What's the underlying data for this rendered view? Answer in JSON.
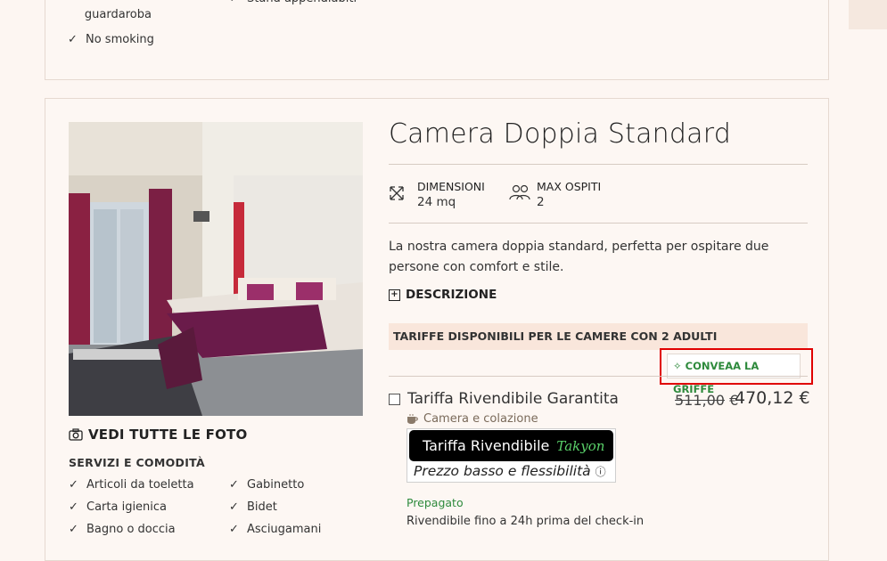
{
  "top_card": {
    "amenities_col1": [
      "Armadio o guardaroba",
      "No smoking"
    ],
    "amenities_col2": [
      "Stand appendiabiti"
    ]
  },
  "room": {
    "title": "Camera Doppia Standard",
    "dimensions_label": "DIMENSIONI",
    "dimensions_value": "24 mq",
    "max_guests_label": "MAX OSPITI",
    "max_guests_value": "2",
    "description": "La nostra camera doppia standard, perfetta per ospitare due persone con comfort e stile.",
    "description_toggle": "DESCRIZIONE",
    "photos_link": "VEDI TUTTE LE FOTO",
    "services_title": "SERVIZI E COMODITÀ",
    "services_col1": [
      "Articoli da toeletta",
      "Carta igienica",
      "Bagno o doccia"
    ],
    "services_col2": [
      "Gabinetto",
      "Bidet",
      "Asciugamani"
    ]
  },
  "rates": {
    "header": "TARIFFE DISPONIBILI PER LE CAMERE CON 2 ADULTI",
    "convert_button": "CONVEAA LA GRIFFE",
    "rate_name": "Tariffa Rivendibile Garantita",
    "old_price": "511,00",
    "currency": "€",
    "price": "470,12 €",
    "meal_plan": "Camera e colazione",
    "badge_title": "Tariffa Rivendibile",
    "badge_brand": "Takyon",
    "badge_subtitle": "Prezzo basso e flessibilità",
    "payment": "Prepagato",
    "resale_info": "Rivendibile fino a 24h prima del check-in"
  },
  "colors": {
    "accent_green": "#2e8a3c",
    "highlight_red": "#e00000",
    "rates_bar": "#f9e6db"
  }
}
